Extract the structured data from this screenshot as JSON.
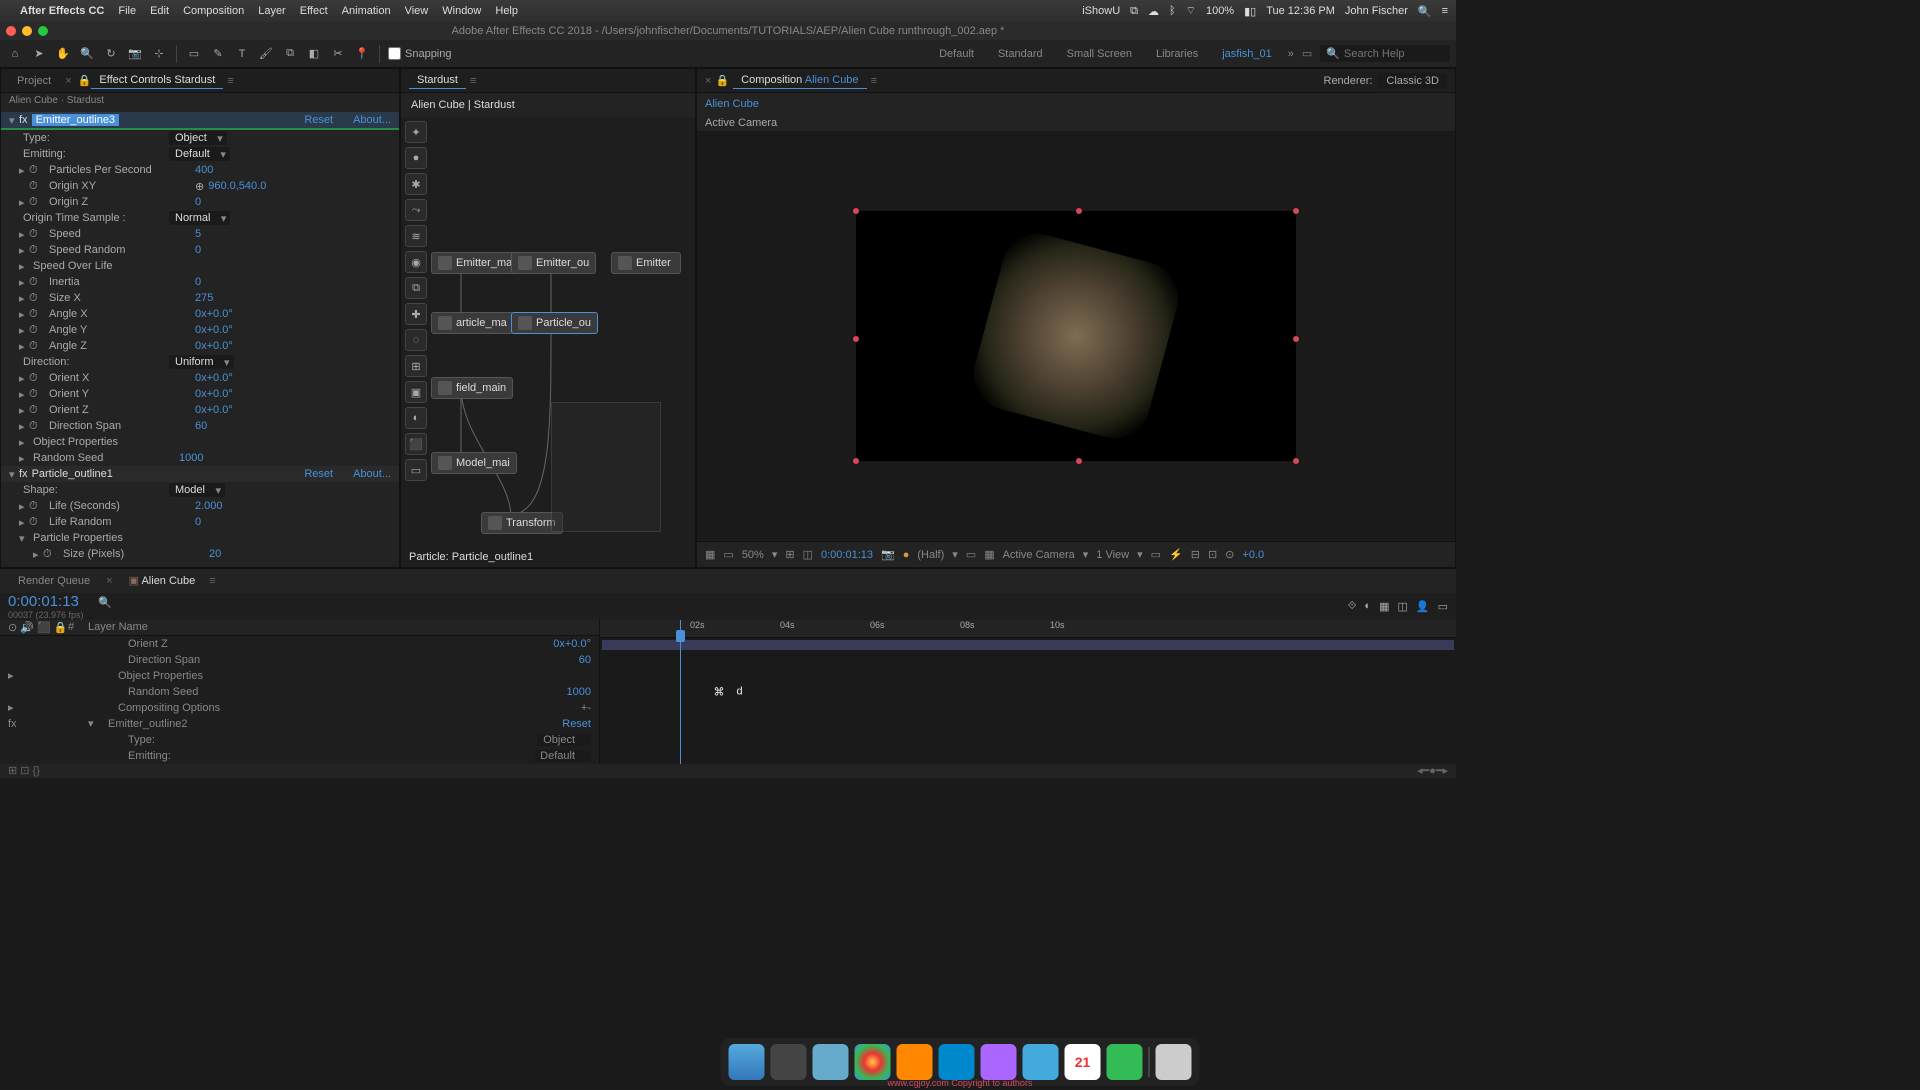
{
  "menubar": {
    "appname": "After Effects CC",
    "items": [
      "File",
      "Edit",
      "Composition",
      "Layer",
      "Effect",
      "Animation",
      "View",
      "Window",
      "Help"
    ],
    "right": {
      "battery": "100%",
      "time": "Tue 12:36 PM",
      "user": "John Fischer",
      "recorder": "iShowU"
    }
  },
  "titlebar": "Adobe After Effects CC 2018 - /Users/johnfischer/Documents/TUTORIALS/AEP/Alien Cube runthrough_002.aep *",
  "toolbar": {
    "snapping_label": "Snapping",
    "workspaces": [
      "Default",
      "Standard",
      "Small Screen",
      "Libraries",
      "jasfish_01"
    ],
    "active_ws": "jasfish_01",
    "search_placeholder": "Search Help"
  },
  "left_panel": {
    "tabs": [
      "Project",
      "Effect Controls Stardust"
    ],
    "active_tab": 1,
    "breadcrumb": "Alien Cube · Stardust",
    "fx1": {
      "name": "Emitter_outline3",
      "reset": "Reset",
      "about": "About...",
      "type_label": "Type:",
      "type_value": "Object",
      "emitting_label": "Emitting:",
      "emitting_value": "Default",
      "pps_label": "Particles Per Second",
      "pps_value": "400",
      "origin_xy_label": "Origin XY",
      "origin_xy_value": "960.0,540.0",
      "origin_z_label": "Origin Z",
      "origin_z_value": "0",
      "ots_label": "Origin Time Sample :",
      "ots_value": "Normal",
      "speed_label": "Speed",
      "speed_value": "5",
      "speedr_label": "Speed Random",
      "speedr_value": "0",
      "sol_label": "Speed Over Life",
      "inertia_label": "Inertia",
      "inertia_value": "0",
      "sizex_label": "Size X",
      "sizex_value": "275",
      "anglex_label": "Angle X",
      "anglex_value": "0x+0.0°",
      "angley_label": "Angle Y",
      "angley_value": "0x+0.0°",
      "anglez_label": "Angle Z",
      "anglez_value": "0x+0.0°",
      "direction_label": "Direction:",
      "direction_value": "Uniform",
      "orientx_label": "Orient X",
      "orientx_value": "0x+0.0°",
      "orienty_label": "Orient Y",
      "orienty_value": "0x+0.0°",
      "orientz_label": "Orient Z",
      "orientz_value": "0x+0.0°",
      "dirspan_label": "Direction Span",
      "dirspan_value": "60",
      "objprop_label": "Object Properties",
      "seed_label": "Random Seed",
      "seed_value": "1000"
    },
    "fx2": {
      "name": "Particle_outline1",
      "reset": "Reset",
      "about": "About...",
      "shape_label": "Shape:",
      "shape_value": "Model",
      "life_label": "Life (Seconds)",
      "life_value": "2.000",
      "lifer_label": "Life Random",
      "lifer_value": "0",
      "pprop_label": "Particle Properties",
      "sizepx_label": "Size (Pixels)",
      "sizepx_value": "20"
    }
  },
  "node_panel": {
    "tab": "Stardust",
    "header": "Alien Cube   |   Stardust",
    "nodes": {
      "n1": "Emitter_ma",
      "n2": "Emitter_ou",
      "n3": "Emitter",
      "n4": "article_ma",
      "n5": "Particle_ou",
      "n6": "field_main",
      "n7": "Model_mai",
      "n8": "Transform"
    },
    "status": "Particle: Particle_outline1"
  },
  "comp_panel": {
    "tab_label": "Composition",
    "comp_name": "Alien Cube",
    "flowchart": "Alien Cube",
    "renderer_label": "Renderer:",
    "renderer_value": "Classic 3D",
    "camera_label": "Active Camera",
    "footer": {
      "zoom": "50%",
      "time": "0:00:01:13",
      "res": "(Half)",
      "camera": "Active Camera",
      "view": "1 View",
      "exposure": "+0.0"
    }
  },
  "timeline": {
    "tabs": [
      "Render Queue",
      "Alien Cube"
    ],
    "active_tab": 1,
    "time": "0:00:01:13",
    "subtime": "00037 (23.976 fps)",
    "rows": {
      "r1": "Orient Z",
      "r1v": "0x+0.0°",
      "r2": "Direction Span",
      "r2v": "60",
      "r3": "Object Properties",
      "r4": "Random Seed",
      "r4v": "1000",
      "r5": "Compositing Options",
      "r6": "Emitter_outline2",
      "r6_reset": "Reset",
      "r7": "Type:",
      "r7v": "Object",
      "r8": "Emitting:",
      "r8v": "Default"
    },
    "ruler": [
      "02s",
      "04s",
      "06s",
      "08s",
      "10s"
    ]
  },
  "key_overlay": {
    "mod": "⌘",
    "key": "d"
  },
  "watermark": "www.cgjoy.com  Copyright to authors"
}
